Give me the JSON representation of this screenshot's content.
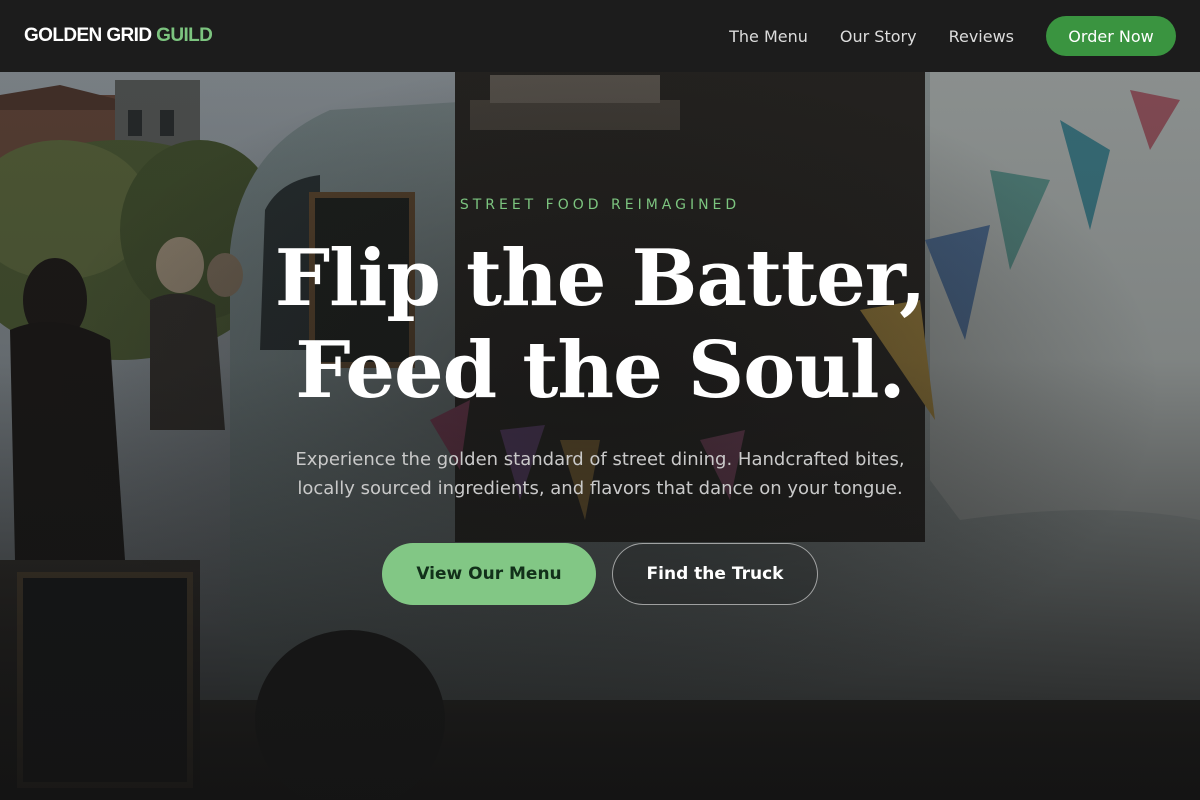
{
  "brand": {
    "name_part1": "GOLDEN GRID ",
    "name_part2": "GUILD",
    "accent_color": "#7cc47f"
  },
  "nav": {
    "links": [
      {
        "label": "The Menu"
      },
      {
        "label": "Our Story"
      },
      {
        "label": "Reviews"
      }
    ],
    "cta_label": "Order Now",
    "cta_color": "#3a9440"
  },
  "hero": {
    "eyebrow": "STREET FOOD REIMAGINED",
    "headline_line1": "Flip the Batter,",
    "headline_line2": "Feed the Soul.",
    "subtext": "Experience the golden standard of street dining. Handcrafted bites, locally sourced ingredients, and flavors that dance on your tongue.",
    "primary_cta": "View Our Menu",
    "secondary_cta": "Find the Truck",
    "primary_color": "#82c785",
    "background_image": "food-truck-photo"
  }
}
